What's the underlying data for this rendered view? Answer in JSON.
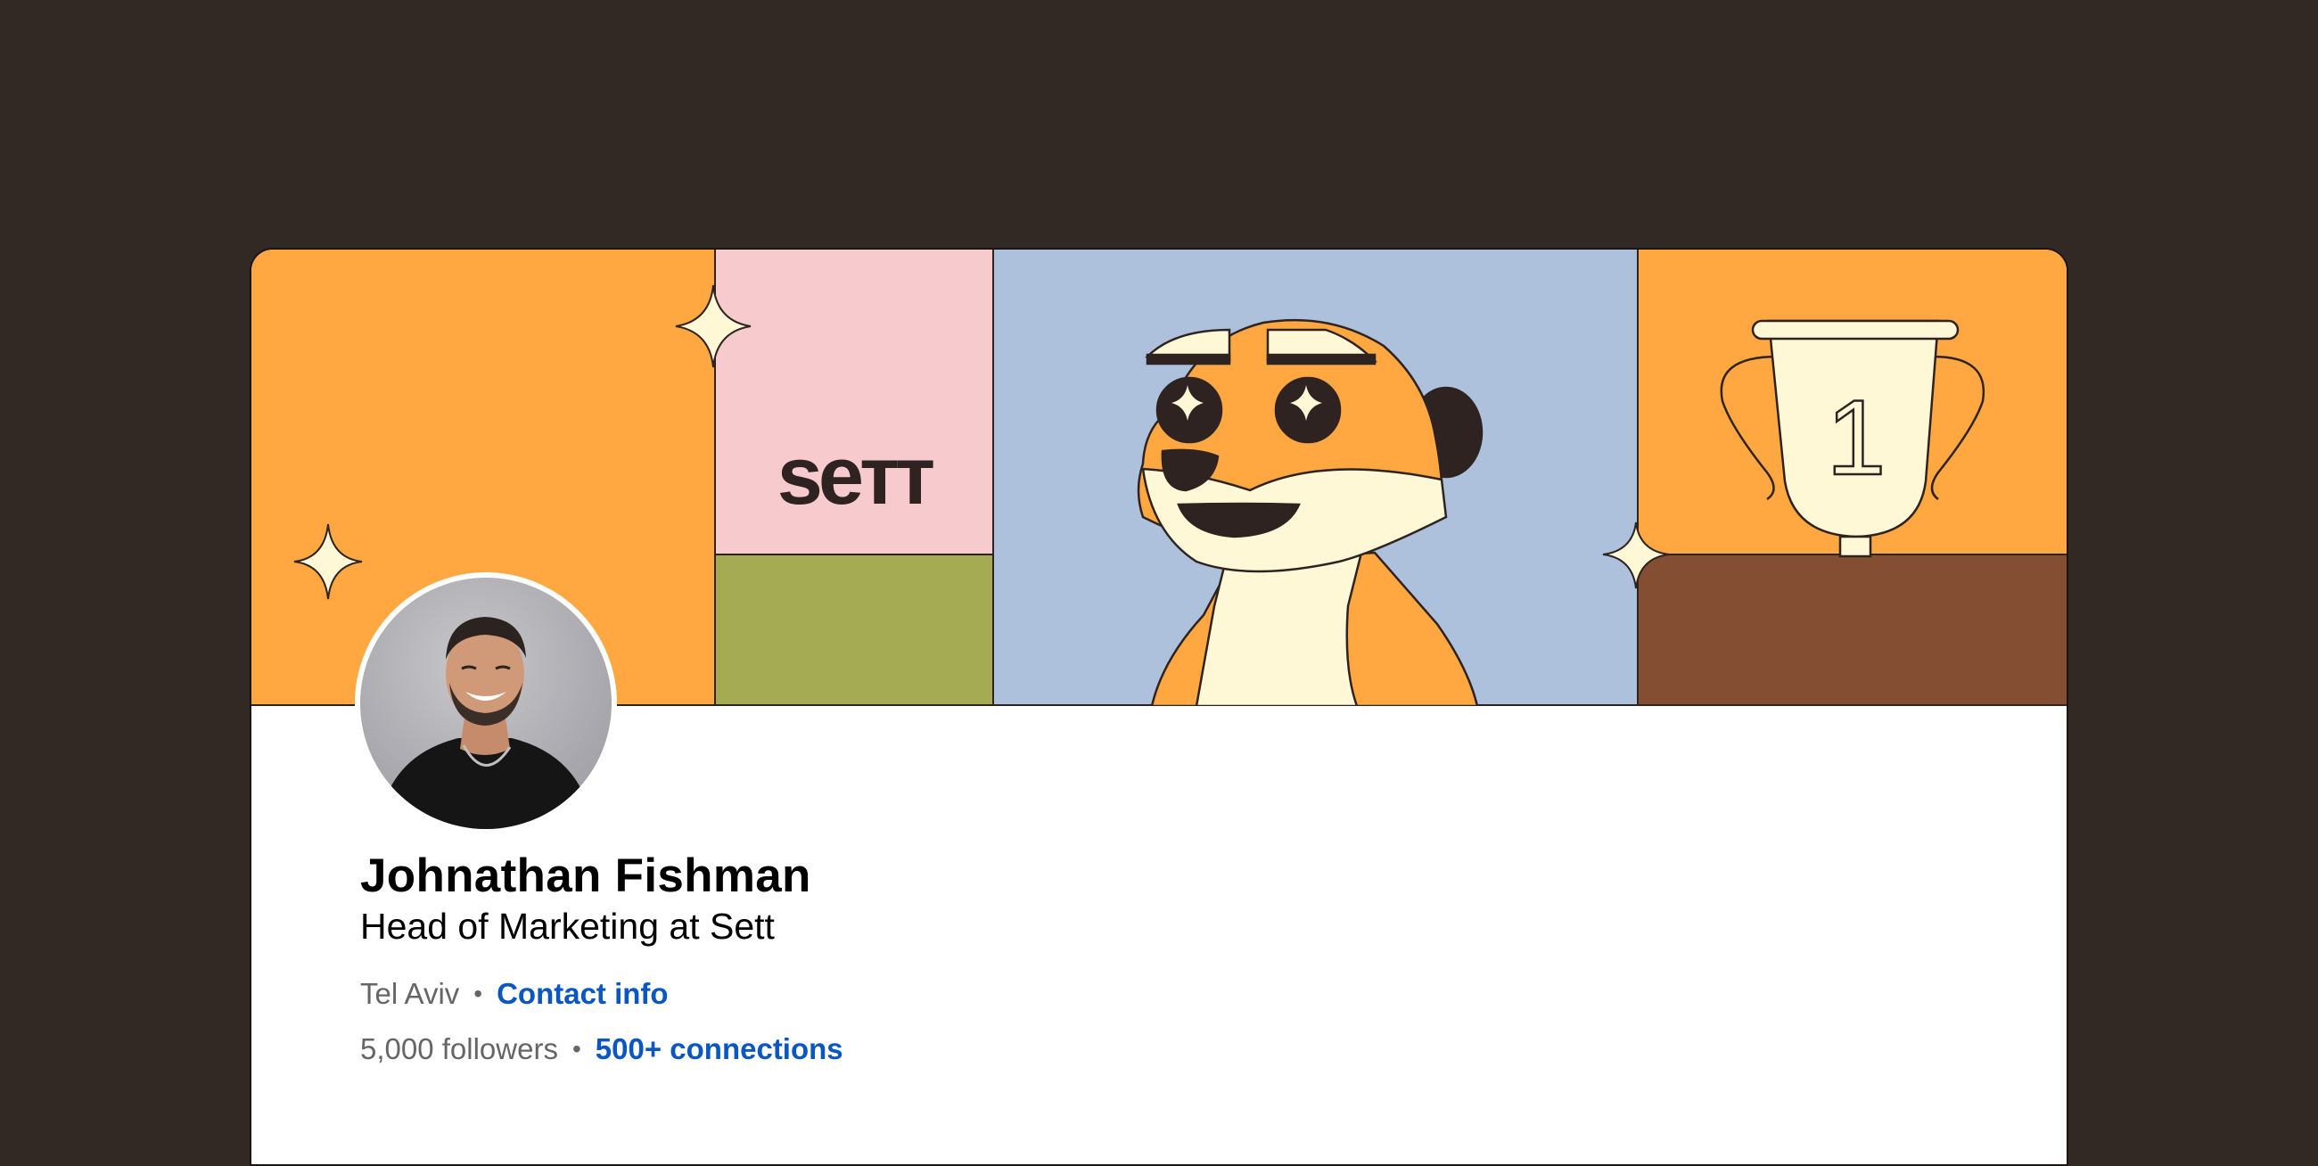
{
  "banner": {
    "logo_text": "seтт",
    "trophy_number": "1",
    "colors": {
      "orange": "#ffa741",
      "pink": "#f7cace",
      "olive": "#a4ab52",
      "sky": "#adc0dc",
      "brown": "#834e31",
      "cream": "#fff8d6",
      "ink": "#2e2320"
    }
  },
  "profile": {
    "name": "Johnathan Fishman",
    "headline": "Head of Marketing at Sett",
    "location": "Tel Aviv",
    "contact_link": "Contact info",
    "followers": "5,000 followers",
    "connections_link": "500+ connections",
    "separator": "•"
  }
}
